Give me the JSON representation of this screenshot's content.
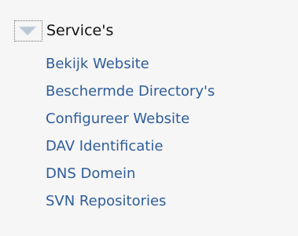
{
  "section": {
    "title": "Service's",
    "toggle_icon": "triangle-down-icon",
    "expanded": true,
    "colors": {
      "background": "#f6f6f6",
      "title": "#111111",
      "link": "#2f5d9a",
      "icon_fill": "#b9c6d4"
    }
  },
  "links": [
    {
      "label": "Bekijk Website"
    },
    {
      "label": "Beschermde Directory's"
    },
    {
      "label": "Configureer Website"
    },
    {
      "label": "DAV Identificatie"
    },
    {
      "label": "DNS Domein"
    },
    {
      "label": "SVN Repositories"
    }
  ]
}
